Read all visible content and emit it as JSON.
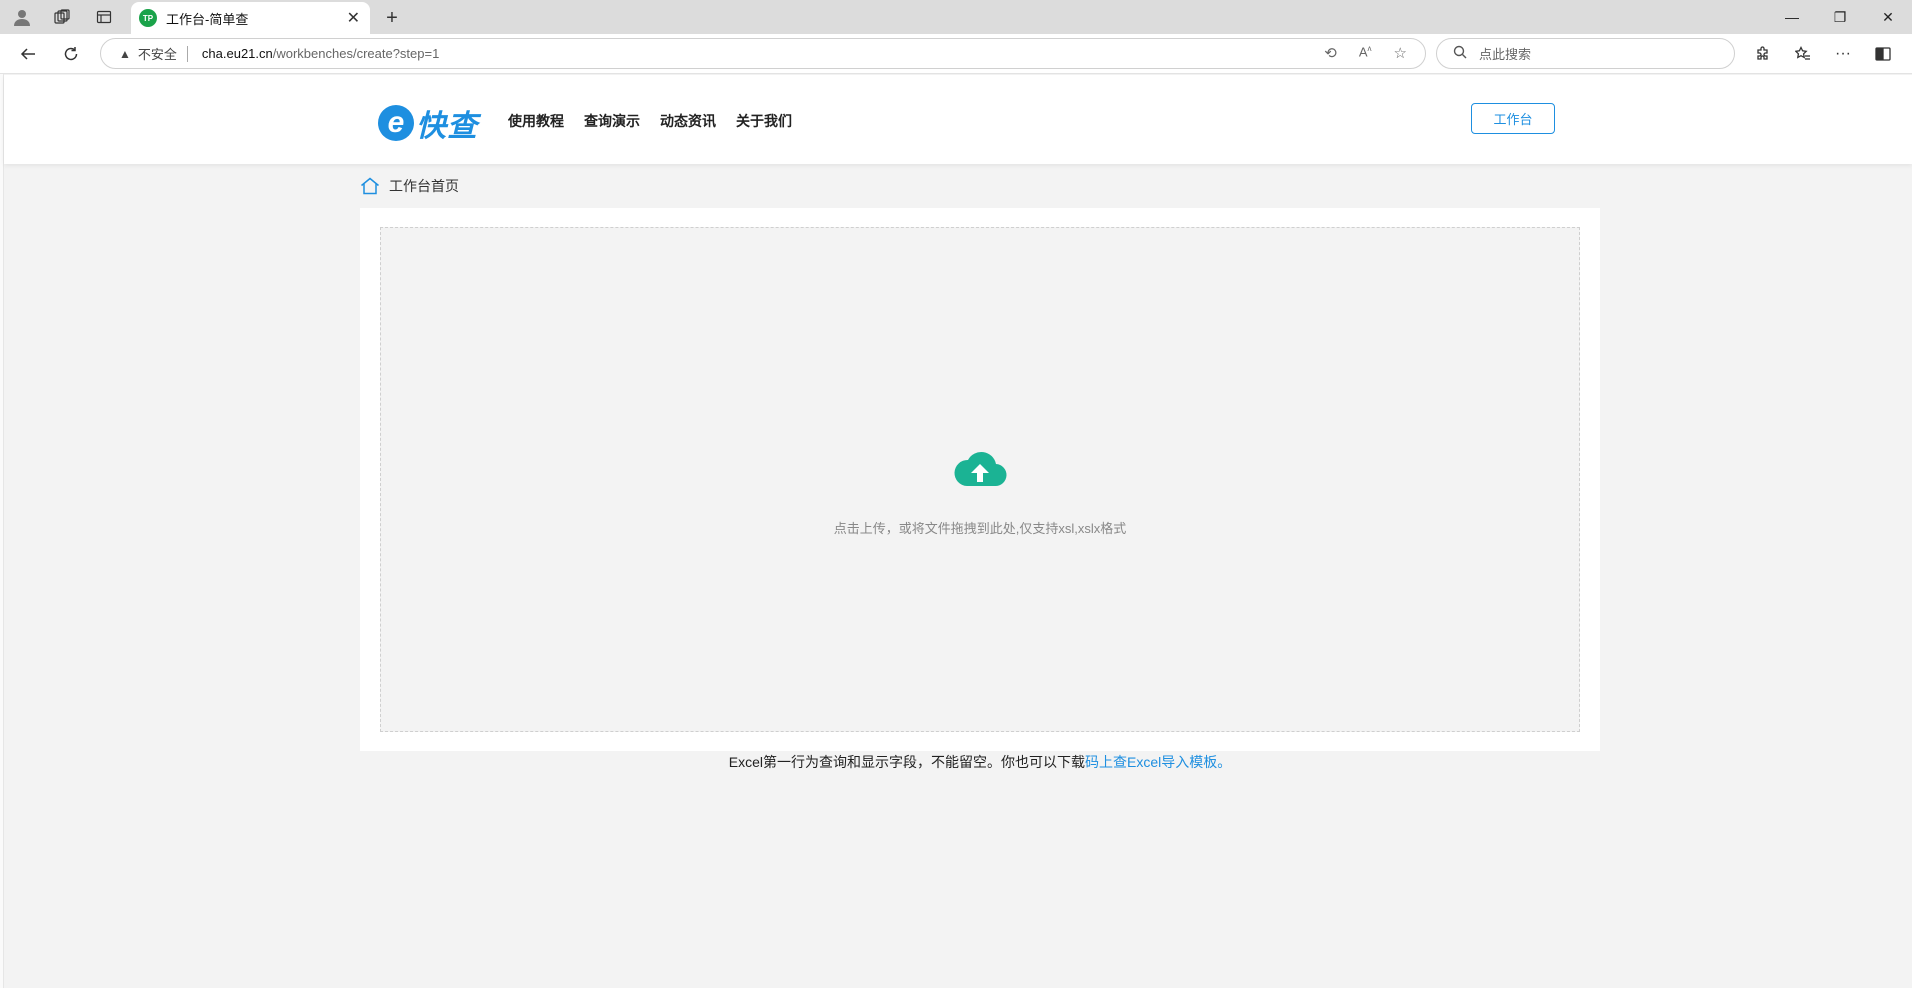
{
  "browser": {
    "tab_title": "工作台-简单查",
    "tab_favicon_text": "TP",
    "security_label": "不安全",
    "url_host": "cha.eu21.cn",
    "url_path": "/workbenches/create?step=1",
    "search_placeholder": "点此搜索"
  },
  "site": {
    "logo_letter": "e",
    "logo_text": "快查",
    "menu": [
      "使用教程",
      "查询演示",
      "动态资讯",
      "关于我们"
    ],
    "workbench_button": "工作台"
  },
  "breadcrumb": {
    "label": "工作台首页"
  },
  "upload": {
    "hint": "点击上传，或将文件拖拽到此处,仅支持xsl,xslx格式"
  },
  "note": {
    "text": "Excel第一行为查询和显示字段，不能留空。你也可以下载",
    "link": "码上查Excel导入模板。"
  },
  "colors": {
    "accent": "#1e8fe0",
    "upload_icon": "#1bb394"
  }
}
